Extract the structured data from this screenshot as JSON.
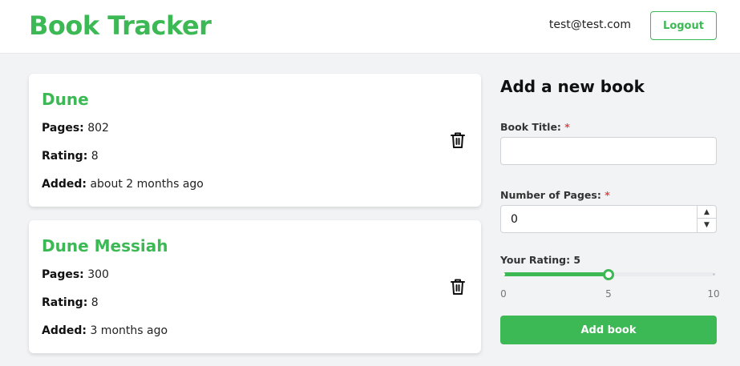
{
  "header": {
    "brand": "Book Tracker",
    "user_email": "test@test.com",
    "logout_label": "Logout"
  },
  "books": [
    {
      "title": "Dune",
      "pages_label": "Pages:",
      "pages": "802",
      "rating_label": "Rating:",
      "rating": "8",
      "added_label": "Added:",
      "added": "about 2 months ago"
    },
    {
      "title": "Dune Messiah",
      "pages_label": "Pages:",
      "pages": "300",
      "rating_label": "Rating:",
      "rating": "8",
      "added_label": "Added:",
      "added": "3 months ago"
    }
  ],
  "form": {
    "heading": "Add a new book",
    "title_label": "Book Title:",
    "title_value": "",
    "pages_label": "Number of Pages:",
    "pages_value": "0",
    "required_mark": "*",
    "rating_label": "Your Rating: 5",
    "rating_value": 5,
    "rating_min": 0,
    "rating_max": 10,
    "tick_min": "0",
    "tick_mid": "5",
    "tick_max": "10",
    "submit_label": "Add book"
  },
  "colors": {
    "accent": "#3cb954",
    "required": "#e04848",
    "background": "#f2f3f5"
  },
  "icons": {
    "delete": "trash-icon",
    "increment": "chevron-up-icon",
    "decrement": "chevron-down-icon"
  }
}
